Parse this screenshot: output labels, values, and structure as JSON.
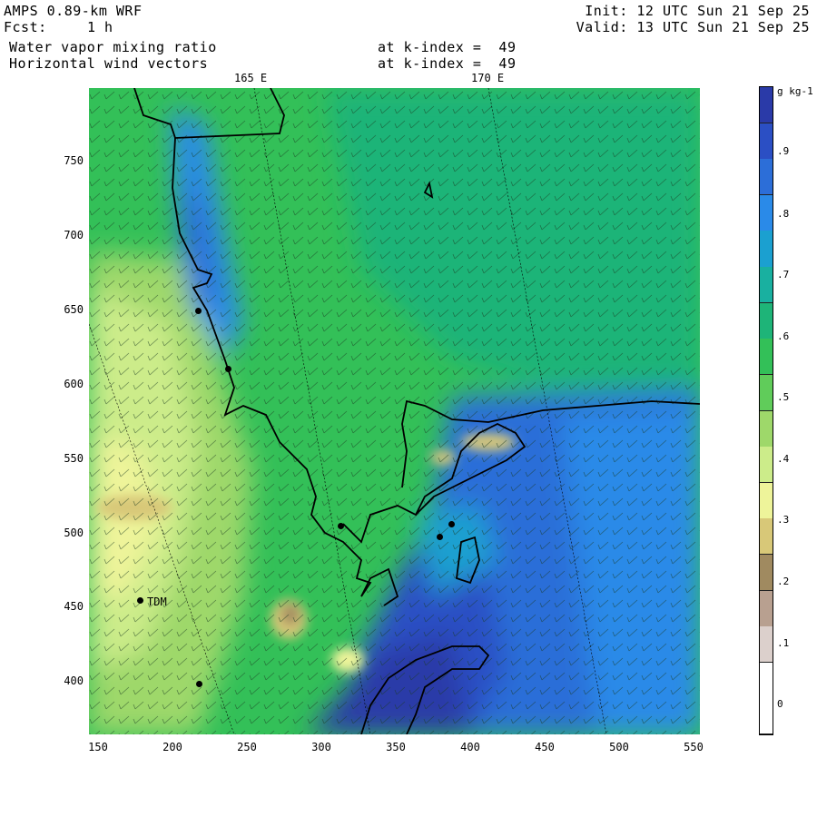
{
  "header": {
    "model": "AMPS 0.89-km WRF",
    "fcst_label": "Fcst:",
    "fcst_value": "1 h",
    "field1": "Water vapor mixing ratio",
    "field1_level": "at k-index =  49",
    "field2": "Horizontal wind vectors",
    "field2_level": "at k-index =  49",
    "init": "Init: 12 UTC Sun 21 Sep 25",
    "valid": "Valid: 13 UTC Sun 21 Sep 25"
  },
  "map": {
    "longitude_labels": [
      "165 E",
      "170 E"
    ],
    "station_label": "TDM",
    "x_ticks": [
      "150",
      "200",
      "250",
      "300",
      "350",
      "400",
      "450",
      "500",
      "550"
    ],
    "y_ticks": [
      "750",
      "700",
      "650",
      "600",
      "550",
      "500",
      "450",
      "400"
    ],
    "xlim": [
      145,
      555
    ],
    "ylim": [
      365,
      800
    ]
  },
  "colorbar": {
    "units": "g kg-1",
    "labels": [
      ".9",
      ".8",
      ".7",
      ".6",
      ".5",
      ".4",
      ".3",
      ".2",
      ".1",
      "0"
    ],
    "colors": [
      "#2a3aa8",
      "#2b4fc4",
      "#2c6ed8",
      "#2a8ae8",
      "#1ba0d0",
      "#19b0a0",
      "#1eb478",
      "#33c058",
      "#60cc5a",
      "#9ed86a",
      "#ccec8a",
      "#eef49a",
      "#d8c878",
      "#a08a60",
      "#b8a090",
      "#dcd0cc",
      "#ffffff",
      "#ffffff"
    ]
  }
}
